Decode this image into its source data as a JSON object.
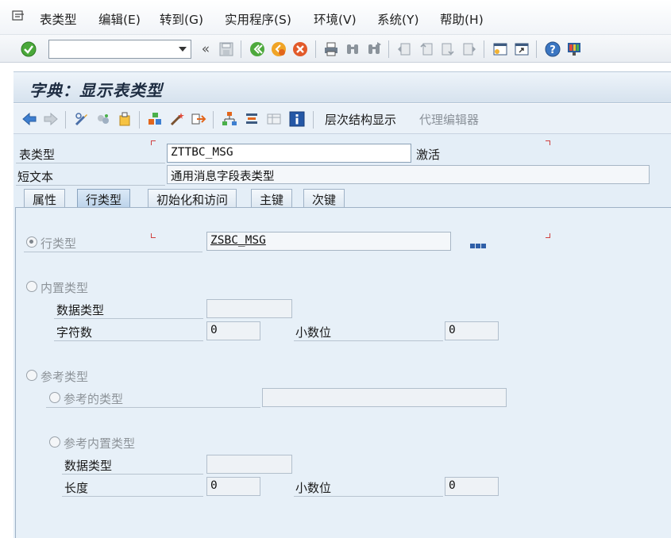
{
  "menu": {
    "items": [
      "表类型",
      "编辑(E)",
      "转到(G)",
      "实用程序(S)",
      "环境(V)",
      "系统(Y)",
      "帮助(H)"
    ]
  },
  "toolbar": {
    "command_value": "",
    "icons": [
      "enter-icon",
      "back-arrows-icon",
      "save-icon",
      "back-icon",
      "exit-icon",
      "cancel-icon",
      "print-icon",
      "find-icon",
      "find-next-icon",
      "first-page-icon",
      "prev-page-icon",
      "next-page-icon",
      "last-page-icon",
      "new-session-icon",
      "shortcut-icon",
      "help-icon",
      "layout-icon"
    ]
  },
  "title": "字典：显示表类型",
  "app_toolbar": {
    "hierarchy_label": "层次结构显示",
    "proxy_editor_label": "代理编辑器"
  },
  "header": {
    "table_type_label": "表类型",
    "table_type_value": "ZTTBC_MSG",
    "status": "激活",
    "short_text_label": "短文本",
    "short_text_value": "通用消息字段表类型"
  },
  "tabs": [
    "属性",
    "行类型",
    "初始化和访问",
    "主键",
    "次键"
  ],
  "active_tab": "行类型",
  "line_type": {
    "option_label": "行类型",
    "value": "ZSBC_MSG"
  },
  "builtin": {
    "option_label": "内置类型",
    "data_type_label": "数据类型",
    "data_type_value": "",
    "chars_label": "字符数",
    "chars_value": "0",
    "decimals_label": "小数位",
    "decimals_value": "0"
  },
  "reference": {
    "option_label": "参考类型",
    "ref_type_label": "参考的类型",
    "ref_type_value": "",
    "ref_builtin_label": "参考内置类型",
    "data_type_label": "数据类型",
    "data_type_value": "",
    "length_label": "长度",
    "length_value": "0",
    "decimals_label": "小数位",
    "decimals_value": "0"
  }
}
